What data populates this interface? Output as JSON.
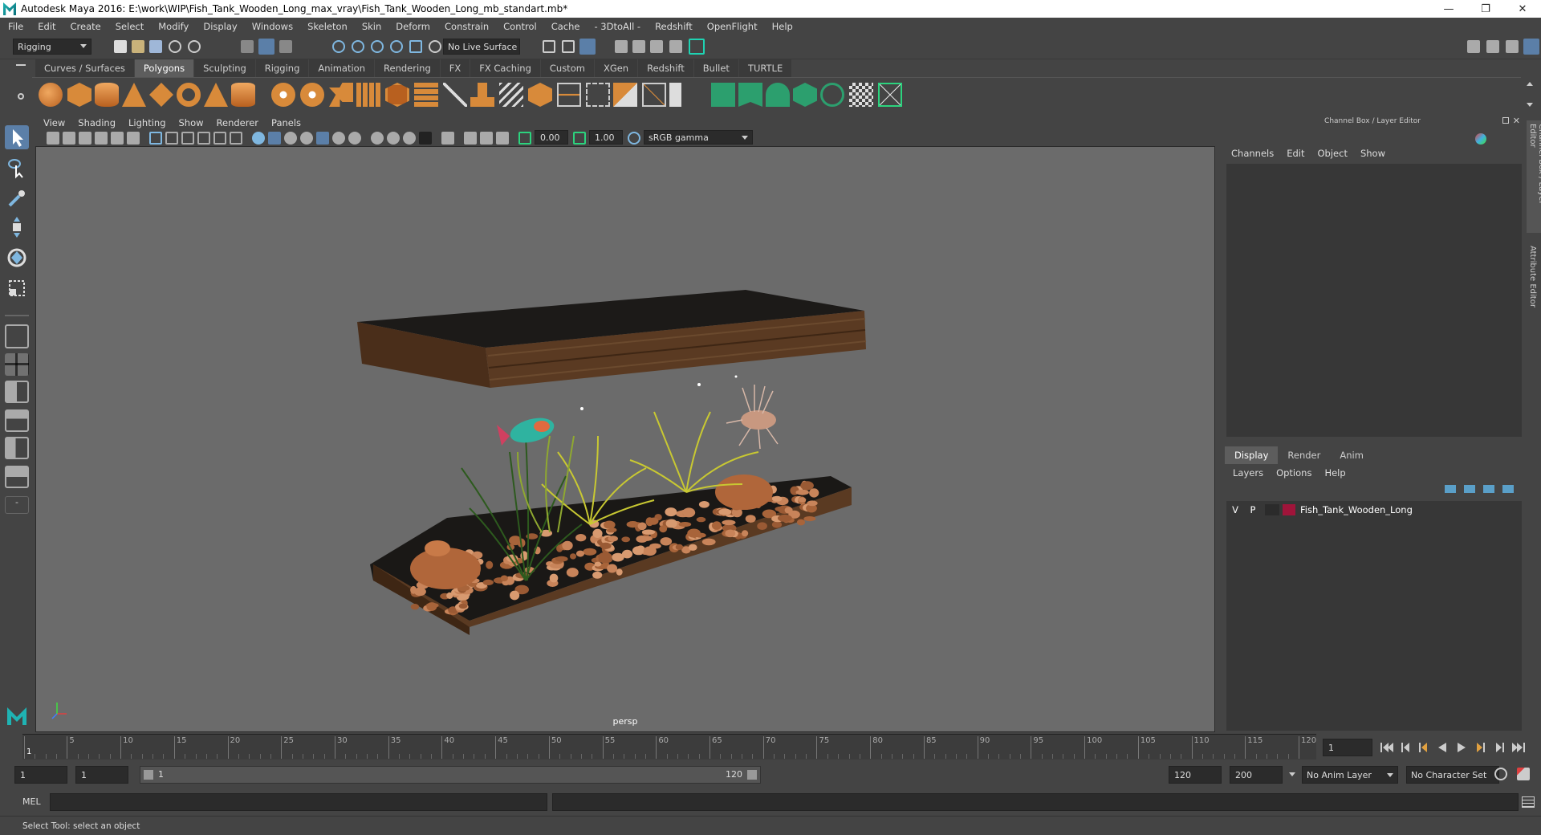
{
  "window": {
    "title": "Autodesk Maya 2016: E:\\work\\WIP\\Fish_Tank_Wooden_Long_max_vray\\Fish_Tank_Wooden_Long_mb_standart.mb*",
    "minimize": "—",
    "restore": "❐",
    "close": "✕"
  },
  "menubar": [
    "File",
    "Edit",
    "Create",
    "Select",
    "Modify",
    "Display",
    "Windows",
    "Skeleton",
    "Skin",
    "Deform",
    "Constrain",
    "Control",
    "Cache",
    "- 3DtoAll -",
    "Redshift",
    "OpenFlight",
    "Help"
  ],
  "statusline": {
    "mode": "Rigging",
    "live_surface": "No Live Surface"
  },
  "shelf_tabs": [
    "Curves / Surfaces",
    "Polygons",
    "Sculpting",
    "Rigging",
    "Animation",
    "Rendering",
    "FX",
    "FX Caching",
    "Custom",
    "XGen",
    "Redshift",
    "Bullet",
    "TURTLE"
  ],
  "shelf_active": "Polygons",
  "viewport": {
    "menu": [
      "View",
      "Shading",
      "Lighting",
      "Show",
      "Renderer",
      "Panels"
    ],
    "exposure": "0.00",
    "gamma": "1.00",
    "colorspace": "sRGB gamma",
    "camera": "persp"
  },
  "right_panel": {
    "title": "Channel Box / Layer Editor",
    "cb_menu": [
      "Channels",
      "Edit",
      "Object",
      "Show"
    ],
    "layer_tabs": [
      "Display",
      "Render",
      "Anim"
    ],
    "layer_tab_active": "Display",
    "layer_menu": [
      "Layers",
      "Options",
      "Help"
    ],
    "layers": [
      {
        "v": "V",
        "p": "P",
        "name": "Fish_Tank_Wooden_Long",
        "color": "#a0143a"
      }
    ]
  },
  "side_tabs": [
    "Channel Box / Layer Editor",
    "Attribute Editor"
  ],
  "timeline": {
    "labels": [
      "1",
      "5",
      "10",
      "15",
      "20",
      "25",
      "30",
      "35",
      "40",
      "45",
      "50",
      "55",
      "60",
      "65",
      "70",
      "75",
      "80",
      "85",
      "90",
      "95",
      "100",
      "105",
      "110",
      "115",
      "120"
    ],
    "current_frame": "1"
  },
  "range": {
    "start": "1",
    "playback_start": "1",
    "slider_start": "1",
    "slider_end": "120",
    "playback_end": "120",
    "end": "200",
    "anim_layer": "No Anim Layer",
    "char_set": "No Character Set"
  },
  "cmdline": {
    "label": "MEL"
  },
  "helpline": "Select Tool: select an object",
  "colors": {
    "accent_teal": "#1fb3b3",
    "wood": "#5a3a22",
    "pebble": "#c8845a",
    "layer_red": "#a0143a"
  }
}
